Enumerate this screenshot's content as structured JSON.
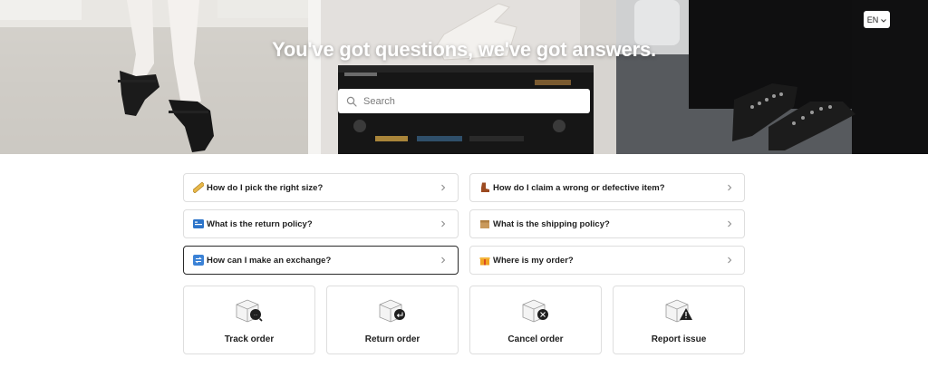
{
  "hero": {
    "title": "You've got questions, we've got answers.",
    "search_placeholder": "Search",
    "language": "EN"
  },
  "faq": [
    {
      "emoji": "ruler-icon",
      "question": "How do I pick the right size?"
    },
    {
      "emoji": "boot-icon",
      "question": "How do I claim a wrong or defective item?"
    },
    {
      "emoji": "return-flag-icon",
      "question": "What is the return policy?"
    },
    {
      "emoji": "package-icon",
      "question": "What is the shipping policy?"
    },
    {
      "emoji": "exchange-icon",
      "question": "How can I make an exchange?"
    },
    {
      "emoji": "gift-icon",
      "question": "Where is my order?"
    }
  ],
  "actions": [
    {
      "label": "Track order",
      "icon": "track-order-icon"
    },
    {
      "label": "Return order",
      "icon": "return-order-icon"
    },
    {
      "label": "Cancel order",
      "icon": "cancel-order-icon"
    },
    {
      "label": "Report issue",
      "icon": "report-issue-icon"
    }
  ],
  "colors": {
    "text": "#1e1e1e",
    "border": "#dedede",
    "active_border": "#2a2a2a",
    "hero_title": "#ffffff"
  }
}
